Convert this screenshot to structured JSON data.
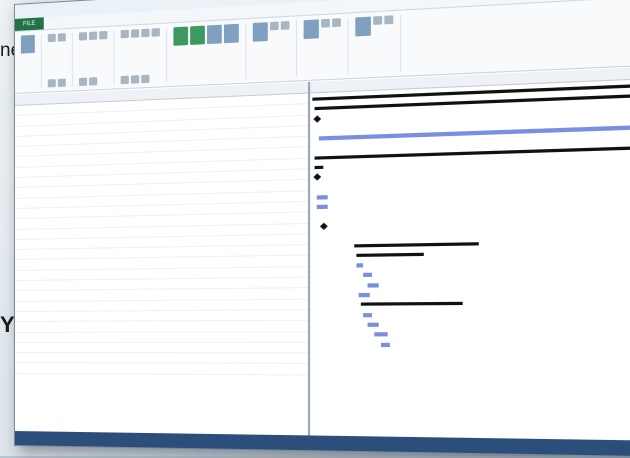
{
  "slide": {
    "fragment_top": "nes.",
    "fragment_bottom": "YECTO"
  },
  "window": {
    "file_tab": "FILE"
  },
  "gantt_rows": 26
}
